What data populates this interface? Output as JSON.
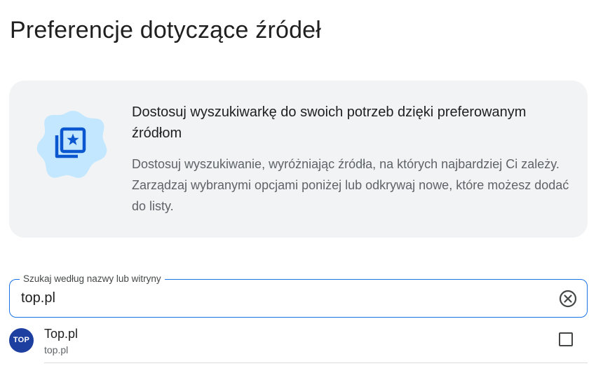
{
  "page": {
    "title": "Preferencje dotyczące źródeł"
  },
  "promo": {
    "icon": "photo-library-star-icon",
    "heading": "Dostosuj wyszukiwarkę do swoich potrzeb dzięki preferowanym źródłom",
    "body": "Dostosuj wyszukiwanie, wyróżniając źródła, na których najbardziej Ci zależy. Zarządzaj wybranymi opcjami poniżej lub odkrywaj nowe, które możesz dodać do listy."
  },
  "search": {
    "label": "Szukaj według nazwy lub witryny",
    "value": "top.pl",
    "clear_icon": "clear-circle-icon"
  },
  "results": [
    {
      "logo_text": "TOP",
      "name": "Top.pl",
      "domain": "top.pl",
      "checked": false
    }
  ],
  "colors": {
    "accent": "#1a73e8",
    "card_background": "#f1f3f4",
    "illustration_blob": "#c2e7ff",
    "illustration_icon": "#0b57d0",
    "logo_background": "#1d3fa0"
  }
}
